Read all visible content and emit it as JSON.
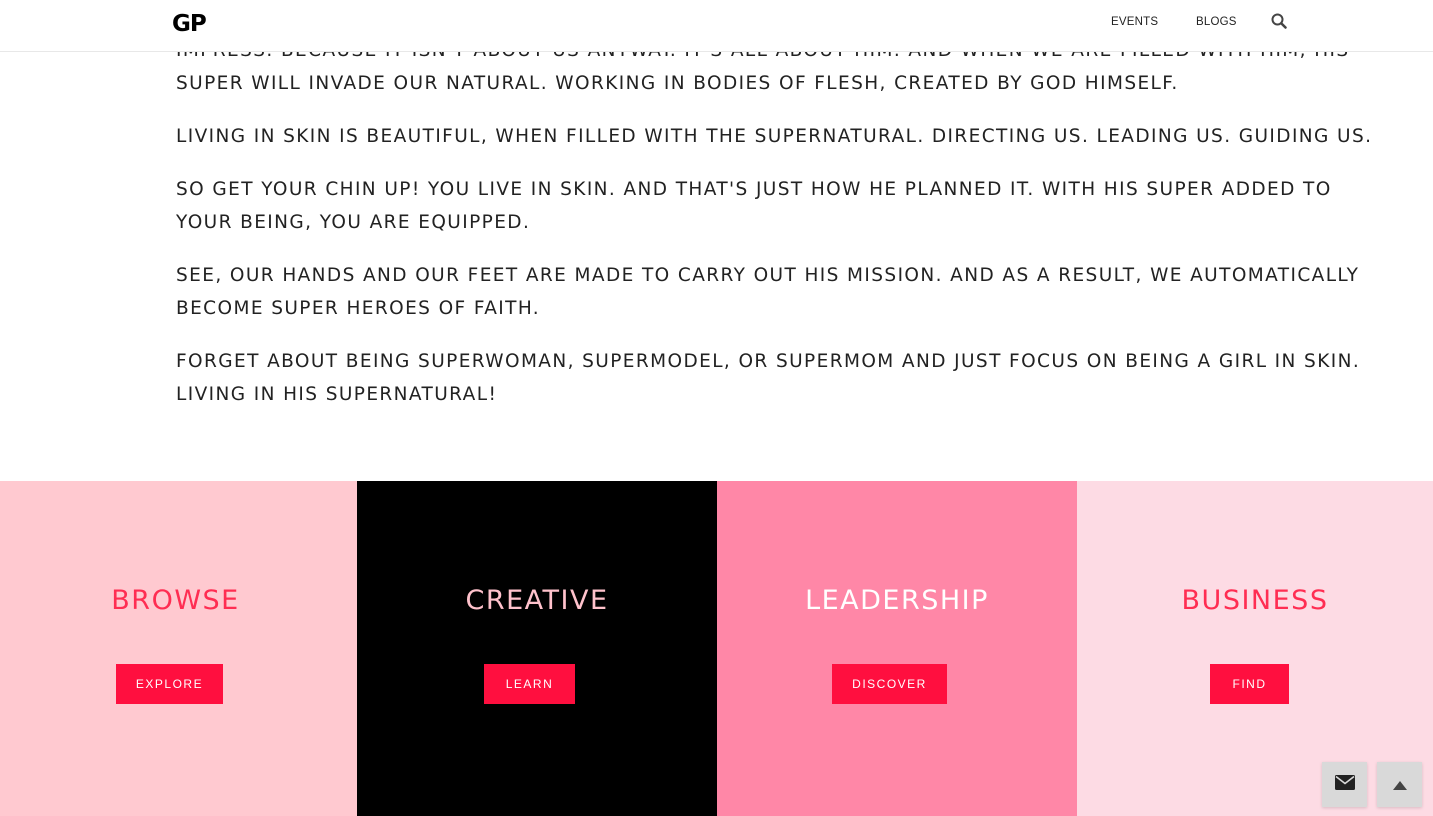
{
  "header": {
    "logo": "GP",
    "nav": [
      {
        "label": "EVENTS"
      },
      {
        "label": "BLOGS"
      }
    ],
    "search_icon": "search-icon"
  },
  "article": {
    "paragraphs": [
      {
        "lines": [
          "IMPRESS. BECAUSE IT ISN'T ABOUT US ANYWAY. IT'S ALL ABOUT HIM. AND WHEN WE ARE FILLED WITH HIM, HIS",
          "SUPER WILL INVADE OUR NATURAL. WORKING IN BODIES OF FLESH, CREATED BY GOD HIMSELF."
        ]
      },
      {
        "lines": [
          "LIVING IN SKIN IS BEAUTIFUL, WHEN FILLED WITH THE SUPERNATURAL. DIRECTING US. LEADING US. GUIDING US."
        ]
      },
      {
        "lines": [
          "SO GET YOUR CHIN UP! YOU LIVE IN SKIN. AND THAT'S JUST HOW HE PLANNED IT. WITH HIS SUPER ADDED TO",
          "YOUR BEING, YOU ARE EQUIPPED."
        ]
      },
      {
        "lines": [
          "SEE, OUR HANDS AND OUR FEET ARE MADE TO CARRY OUT HIS MISSION. AND AS A RESULT, WE AUTOMATICALLY",
          "BECOME SUPER HEROES OF FAITH."
        ]
      },
      {
        "lines": [
          "FORGET ABOUT BEING SUPERWOMAN, SUPERMODEL, OR SUPERMOM AND JUST FOCUS ON BEING A GIRL IN SKIN.",
          "LIVING IN HIS SUPERNATURAL!"
        ]
      }
    ]
  },
  "tiles": [
    {
      "title": "BROWSE",
      "button": "EXPLORE",
      "bg": "#ffc9d0",
      "title_color": "#ff2d52"
    },
    {
      "title": "CREATIVE",
      "button": "LEARN",
      "bg": "#000000",
      "title_color": "#ffc2cc"
    },
    {
      "title": "LEADERSHIP",
      "button": "DISCOVER",
      "bg": "#ff87a7",
      "title_color": "#ffffff"
    },
    {
      "title": "BUSINESS",
      "button": "FIND",
      "bg": "#fddbe4",
      "title_color": "#ff2d52"
    }
  ],
  "floating": {
    "contact_icon": "envelope-icon",
    "top_icon": "arrow-up-icon"
  },
  "colors": {
    "accent": "#ff0f3f",
    "text": "#222222"
  }
}
